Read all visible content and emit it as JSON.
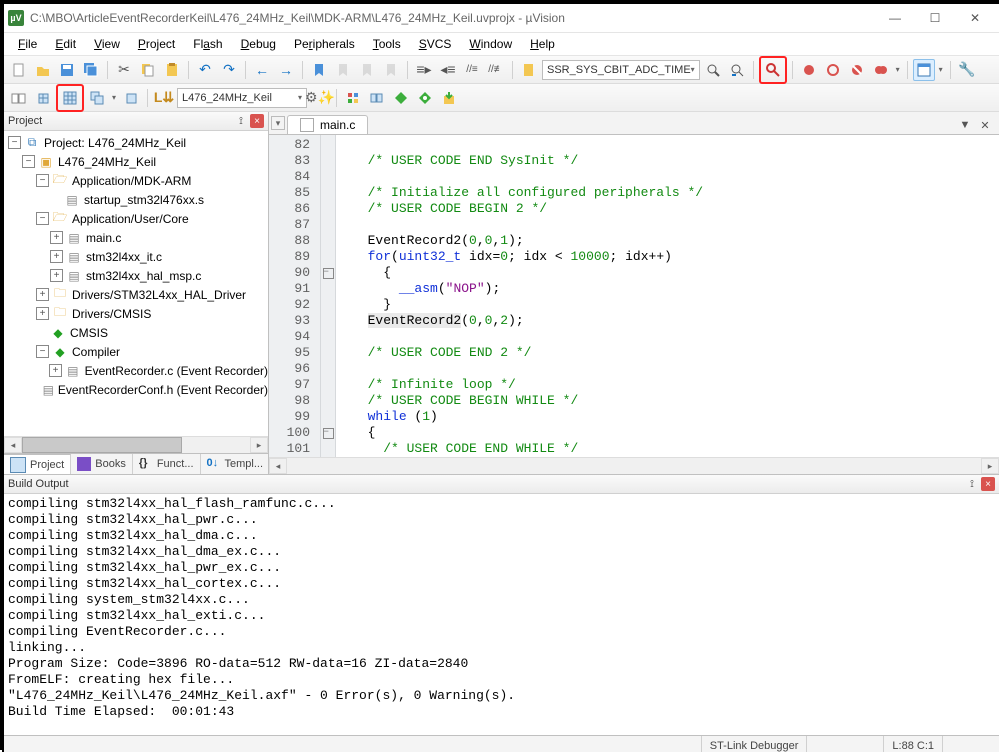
{
  "window": {
    "title": "C:\\MBO\\ArticleEventRecorderKeil\\L476_24MHz_Keil\\MDK-ARM\\L476_24MHz_Keil.uvprojx - µVision",
    "app_icon_text": "µV"
  },
  "menu": {
    "file": "File",
    "edit": "Edit",
    "view": "View",
    "project": "Project",
    "flash": "Flash",
    "debug": "Debug",
    "peripherals": "Peripherals",
    "tools": "Tools",
    "svcs": "SVCS",
    "window": "Window",
    "help": "Help"
  },
  "toolbar1": {
    "search_text": "SSR_SYS_CBIT_ADC_TIME"
  },
  "toolbar2": {
    "target_name": "L476_24MHz_Keil"
  },
  "project_panel": {
    "title": "Project",
    "root": "Project: L476_24MHz_Keil",
    "target": "L476_24MHz_Keil",
    "groups": [
      {
        "name": "Application/MDK-ARM",
        "files": [
          "startup_stm32l476xx.s"
        ]
      },
      {
        "name": "Application/User/Core",
        "files": [
          "main.c",
          "stm32l4xx_it.c",
          "stm32l4xx_hal_msp.c"
        ]
      },
      {
        "name": "Drivers/STM32L4xx_HAL_Driver",
        "files": []
      },
      {
        "name": "Drivers/CMSIS",
        "files": []
      },
      {
        "name": "CMSIS",
        "files": []
      },
      {
        "name": "Compiler",
        "files": [
          "EventRecorder.c (Event Recorder)",
          "EventRecorderConf.h (Event Recorder)"
        ]
      }
    ],
    "tabs": {
      "project": "Project",
      "books": "Books",
      "functions": "Funct...",
      "templates": "Templ..."
    }
  },
  "editor": {
    "tab_label": "main.c",
    "first_line_no": 82,
    "lines": [
      "",
      "  /* USER CODE END SysInit */",
      "",
      "  /* Initialize all configured peripherals */",
      "  /* USER CODE BEGIN 2 */",
      "",
      "  EventRecord2(0,0,1);",
      "  for(uint32_t idx=0; idx < 10000; idx++)",
      "    {",
      "      __asm(\"NOP\");",
      "    }",
      "  EventRecord2(0,0,2);",
      "",
      "  /* USER CODE END 2 */",
      "",
      "  /* Infinite loop */",
      "  /* USER CODE BEGIN WHILE */",
      "  while (1)",
      "  {",
      "    /* USER CODE END WHILE */"
    ]
  },
  "build": {
    "title": "Build Output",
    "lines": [
      "compiling stm32l4xx_hal_flash_ramfunc.c...",
      "compiling stm32l4xx_hal_pwr.c...",
      "compiling stm32l4xx_hal_dma.c...",
      "compiling stm32l4xx_hal_dma_ex.c...",
      "compiling stm32l4xx_hal_pwr_ex.c...",
      "compiling stm32l4xx_hal_cortex.c...",
      "compiling system_stm32l4xx.c...",
      "compiling stm32l4xx_hal_exti.c...",
      "compiling EventRecorder.c...",
      "linking...",
      "Program Size: Code=3896 RO-data=512 RW-data=16 ZI-data=2840",
      "FromELF: creating hex file...",
      "\"L476_24MHz_Keil\\L476_24MHz_Keil.axf\" - 0 Error(s), 0 Warning(s).",
      "Build Time Elapsed:  00:01:43"
    ]
  },
  "status": {
    "debugger": "ST-Link Debugger",
    "pos": "L:88 C:1"
  },
  "colors": {
    "highlight_border": "#f22222"
  }
}
